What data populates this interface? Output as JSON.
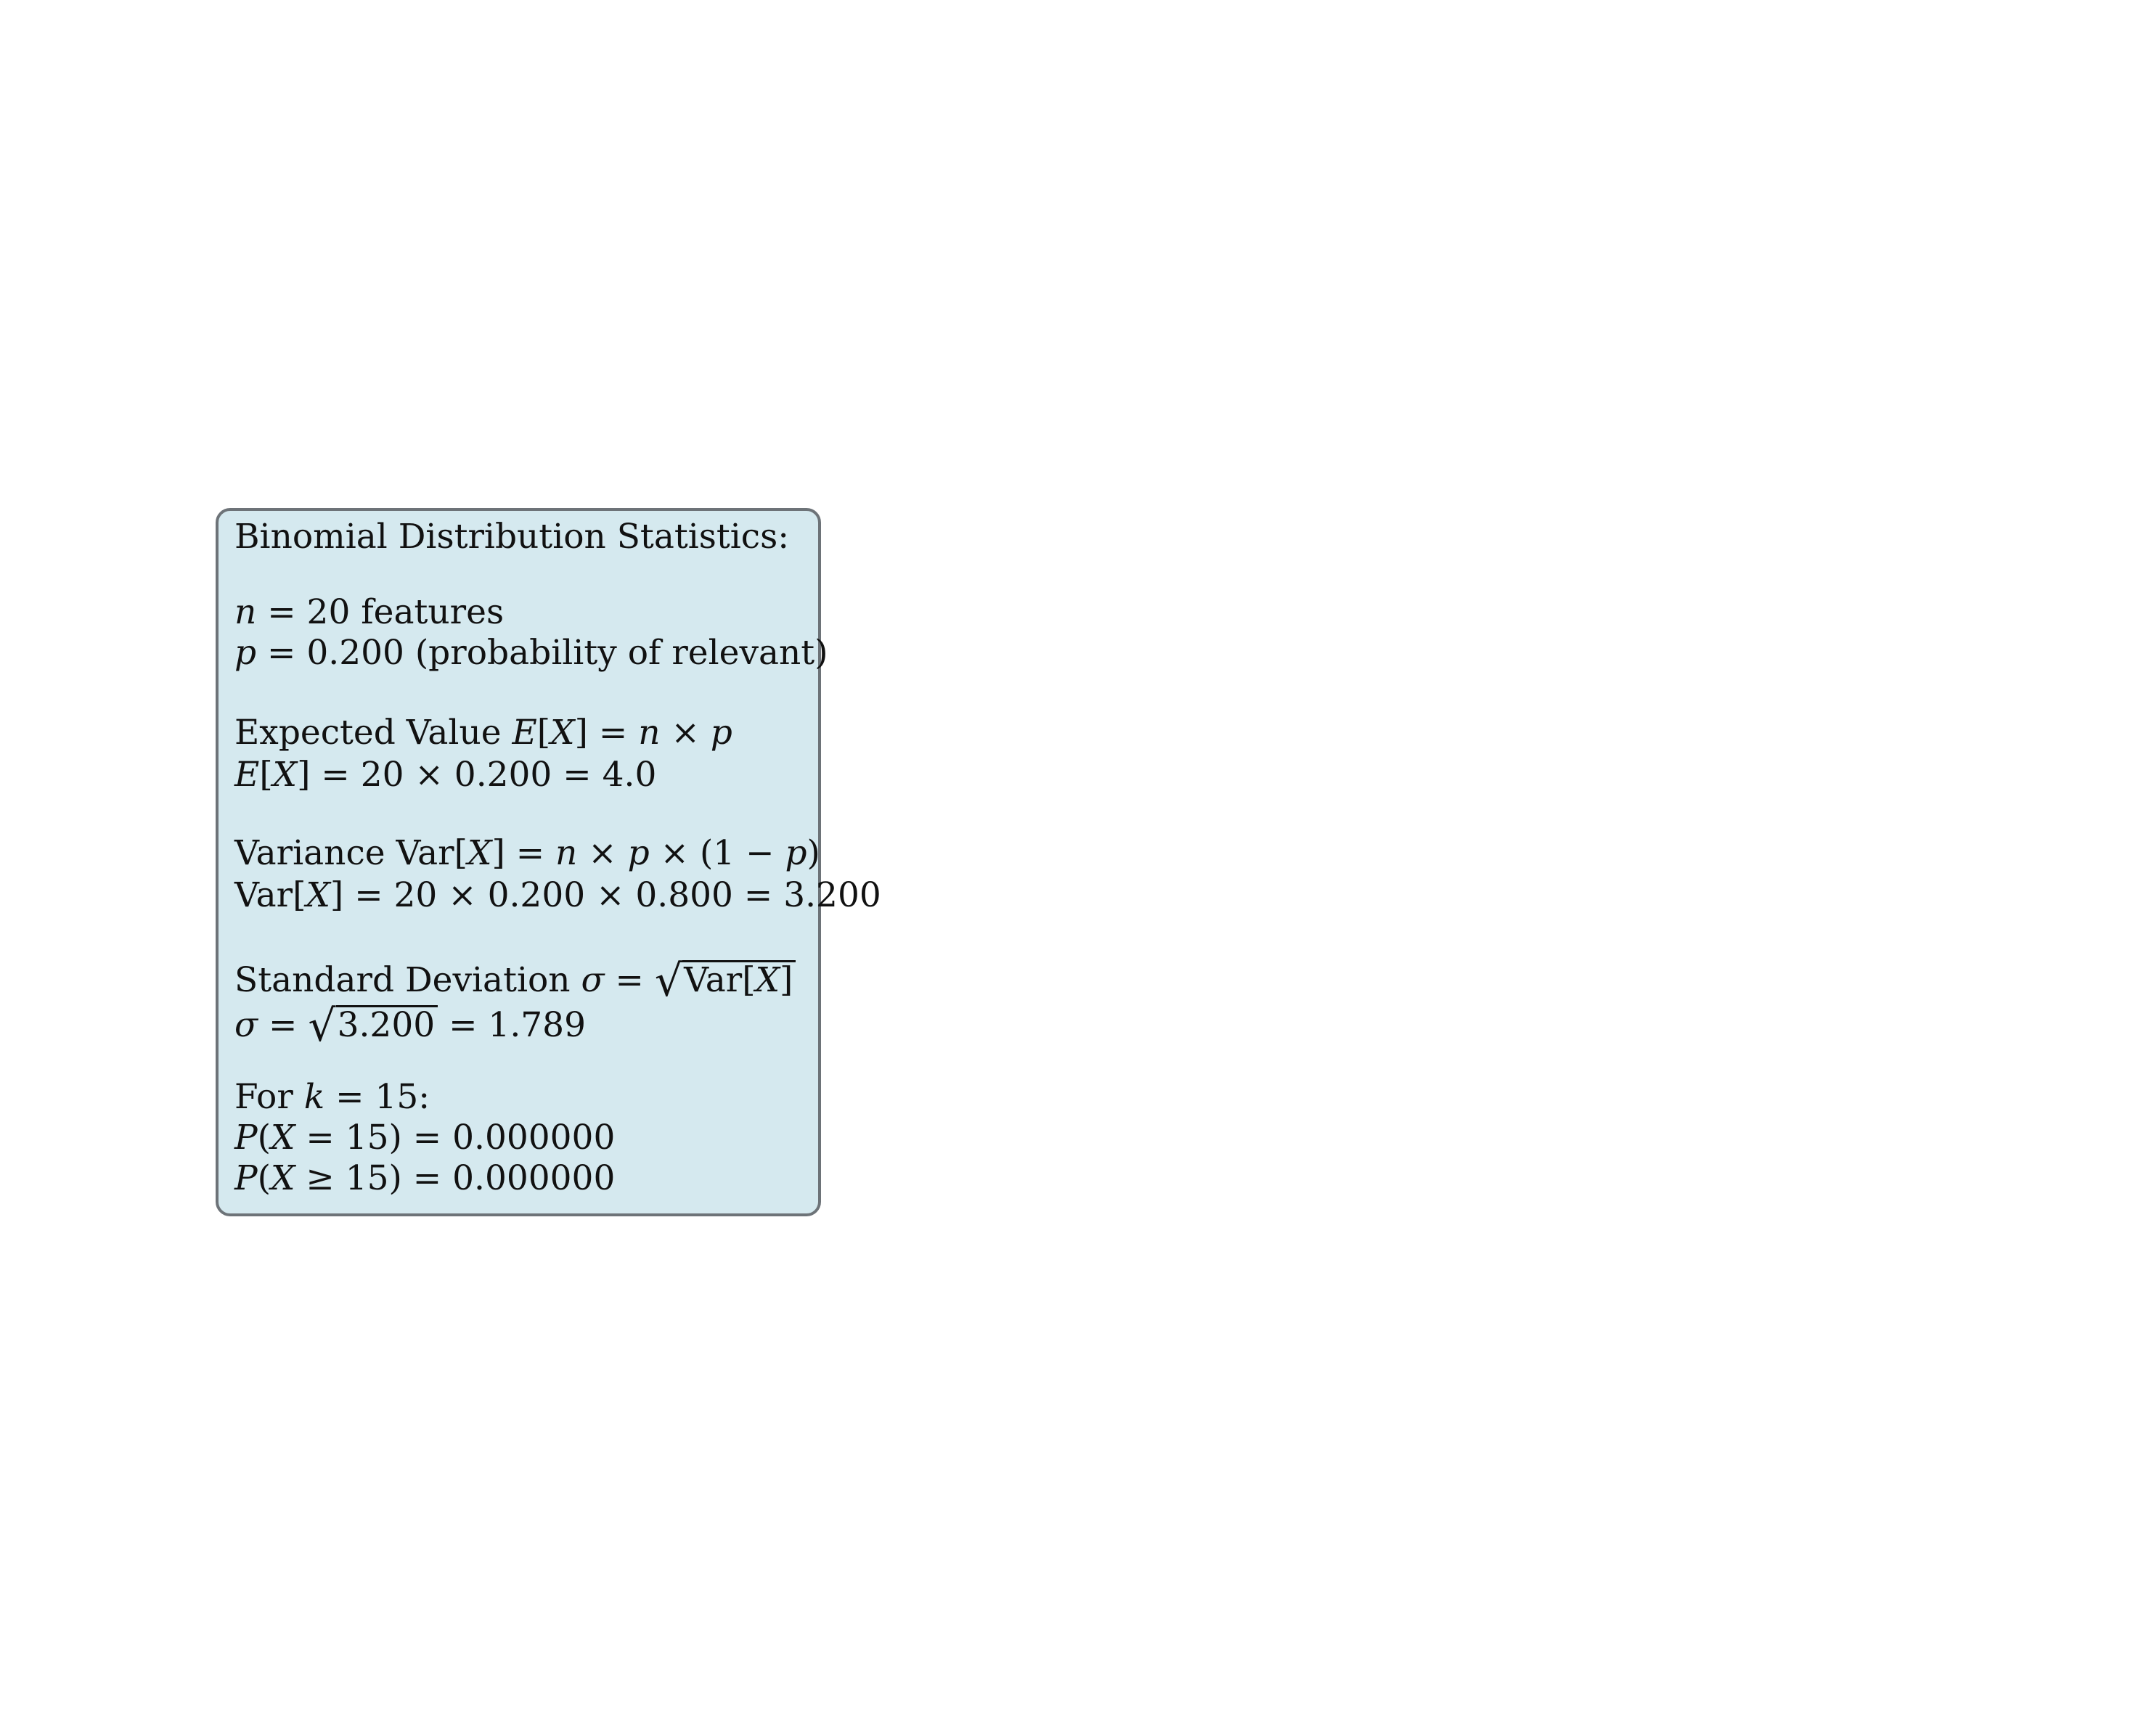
{
  "title": "Binomial Distribution Statistics:",
  "params": {
    "n_var": "n",
    "n_rest": " = 20 features",
    "p_var": "p",
    "p_rest": " = 0.200 (probability of relevant)"
  },
  "expected": {
    "label": "Expected Value ",
    "def_e": "E",
    "def_open": "[",
    "def_x": "X",
    "def_close": "] = ",
    "def_n": "n",
    "def_times": " × ",
    "def_p": "p",
    "calc_e": "E",
    "calc_open": "[",
    "calc_x": "X",
    "calc_rest": "] = 20 × 0.200 = 4.0"
  },
  "variance": {
    "label": "Variance Var[",
    "def_x": "X",
    "def_eq": "] = ",
    "def_n": "n",
    "def_t1": " × ",
    "def_p": "p",
    "def_t2": " × (1 − ",
    "def_p2": "p",
    "def_end": ")",
    "calc_pre": "Var[",
    "calc_x": "X",
    "calc_rest": "] = 20 × 0.200 × 0.800 = 3.200"
  },
  "stddev": {
    "label": "Standard Deviation ",
    "sigma": "σ",
    "eq": " = ",
    "radical": "√",
    "radicand_pre": "Var[",
    "radicand_x": "X",
    "radicand_post": "]",
    "calc_sigma": "σ",
    "calc_eq": " = ",
    "calc_radicand": "3.200",
    "calc_result": " = 1.789"
  },
  "k_block": {
    "for_label": "For ",
    "k_var": "k",
    "k_rest": " = 15:",
    "pmf_p": "P",
    "pmf_open": "(",
    "pmf_x": "X",
    "pmf_rest": " = 15) = 0.000000",
    "cdf_p": "P",
    "cdf_open": "(",
    "cdf_x": "X",
    "cdf_rest": " ≥ 15) = 0.000000"
  },
  "colors": {
    "box_fill": "#d5e9ef",
    "box_border": "#6d7378",
    "text": "#111111"
  }
}
